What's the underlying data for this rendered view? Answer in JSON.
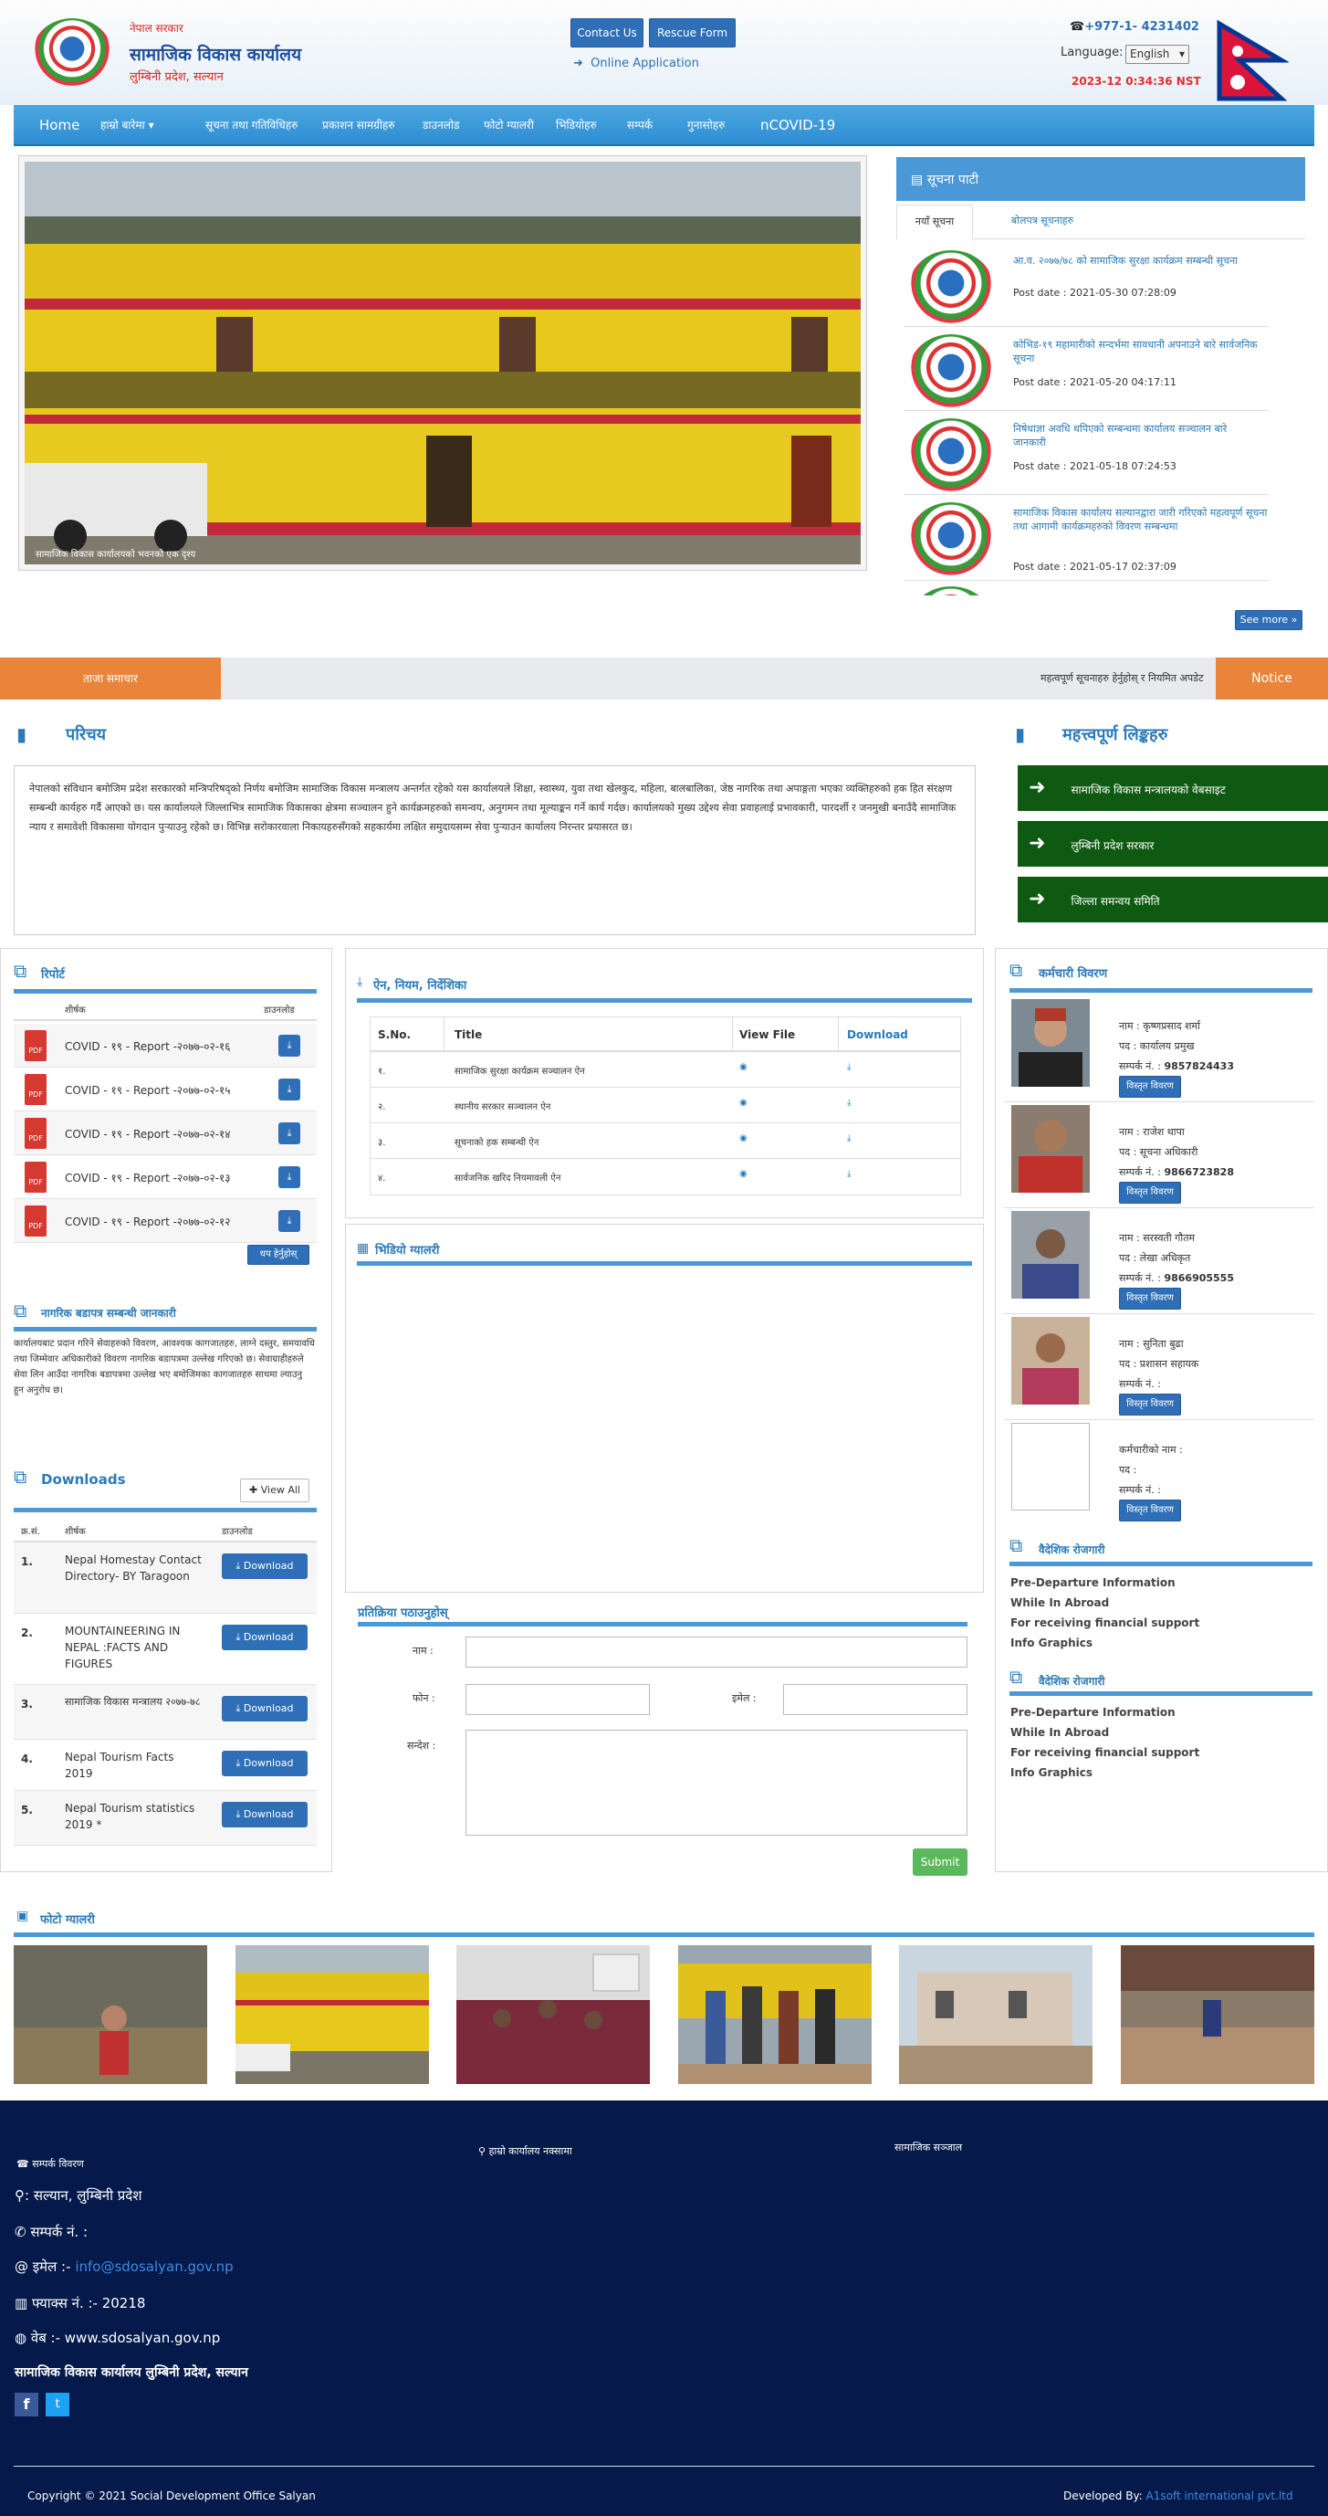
{
  "header": {
    "gov_line1": "नेपाल सरकार",
    "office_name": "सामाजिक विकास कार्यालय",
    "office_sub": "लुम्बिनी प्रदेश, सल्यान",
    "contact_us": "Contact Us",
    "rescue_form": "Rescue Form",
    "online_application": "Online Application",
    "phone": "+977-1- 4231402",
    "language_label": "Language:",
    "language_selected": "English",
    "datetime": "2023-12 0:34:36 NST"
  },
  "nav": {
    "items": [
      "Home",
      "हाम्रो बारेमा",
      "सूचना तथा गतिविधिहरु",
      "प्रकाशन सामग्रीहरु",
      "डाउनलोड",
      "फोटो ग्यालरी",
      "भिडियोहरु",
      "सम्पर्क",
      "गुनासोहरु",
      "nCOVID-19"
    ]
  },
  "slider": {
    "caption": "सामाजिक विकास कार्यालयको भवनको एक दृश्य"
  },
  "news": {
    "title": "सूचना पाटी",
    "tabs": [
      "नयाँ सूचना",
      "बोलपत्र सूचनाहरु"
    ],
    "items": [
      {
        "text": "आ.व. २०७७/७८ को सामाजिक सुरक्षा कार्यक्रम सम्बन्धी सूचना",
        "date": "Post date : 2021-05-30 07:28:09"
      },
      {
        "text": "कोभिड-१९ महामारीको सन्दर्भमा सावधानी अपनाउने बारे सार्वजनिक सूचना",
        "date": "Post date : 2021-05-20 04:17:11"
      },
      {
        "text": "निषेधाज्ञा अवधि थपिएको सम्बन्धमा कार्यालय सञ्चालन बारे जानकारी",
        "date": "Post date : 2021-05-18 07:24:53"
      },
      {
        "text": "सामाजिक विकास कार्यालय सल्यानद्वारा जारी गरिएको महत्वपूर्ण सूचना तथा आगामी कार्यक्रमहरुको विवरण सम्बन्धमा",
        "date": "Post date : 2021-05-17 02:37:09"
      }
    ],
    "see_more": "See more »"
  },
  "ticker": {
    "label": "ताजा समाचार",
    "text": "महत्वपूर्ण सूचनाहरु हेर्नुहोस् र नियमित अपडेट रहनुहोस्",
    "notice": "Notice"
  },
  "intro": {
    "title": "परिचय",
    "body": "नेपालको संविधान बमोजिम प्रदेश सरकारको मन्त्रिपरिषद्को निर्णय बमोजिम सामाजिक विकास मन्त्रालय अन्तर्गत रहेको यस कार्यालयले शिक्षा, स्वास्थ्य, युवा तथा खेलकुद, महिला, बालबालिका, जेष्ठ नागरिक तथा अपाङ्गता भएका व्यक्तिहरुको हक हित संरक्षण सम्बन्धी कार्यहरु गर्दै आएको छ। यस कार्यालयले जिल्लाभित्र सामाजिक विकासका क्षेत्रमा सञ्चालन हुने कार्यक्रमहरुको समन्वय, अनुगमन तथा मूल्याङ्कन गर्ने कार्य गर्दछ। कार्यालयको मुख्य उद्देश्य सेवा प्रवाहलाई प्रभावकारी, पारदर्शी र जनमुखी बनाउँदै सामाजिक न्याय र समावेशी विकासमा योगदान पुर्‍याउनु रहेको छ। विभिन्न सरोकारवाला निकायहरुसँगको सहकार्यमा लक्षित समुदायसम्म सेवा पुर्‍याउन कार्यालय निरन्तर प्रयासरत छ।"
  },
  "quick_links": {
    "title": "महत्त्वपूर्ण लिङ्कहरु",
    "items": [
      "सामाजिक विकास मन्त्रालयको वेबसाइट",
      "लुम्बिनी प्रदेश सरकार",
      "जिल्ला समन्वय समिति"
    ]
  },
  "reports": {
    "title": "रिपोर्ट",
    "col_name": "शीर्षक",
    "col_dl": "डाउनलोड",
    "items": [
      "COVID - १९ - Report -२०७७-०२-१६",
      "COVID - १९ - Report -२०७७-०२-१५",
      "COVID - १९ - Report -२०७७-०२-१४",
      "COVID - १९ - Report -२०७७-०२-१३",
      "COVID - १९ - Report -२०७७-०२-१२"
    ],
    "view_all": "थप हेर्नुहोस्"
  },
  "citizen": {
    "title": "नागरिक बडापत्र सम्बन्धी जानकारी",
    "body": "कार्यालयबाट प्रदान गरिने सेवाहरुको विवरण, आवश्यक कागजातहरु, लाग्ने दस्तुर, समयावधि तथा जिम्मेवार अधिकारीको विवरण नागरिक बडापत्रमा उल्लेख गरिएको छ। सेवाग्राहीहरुले सेवा लिन आउँदा नागरिक बडापत्रमा उल्लेख भए बमोजिमका कागजातहरु साथमा ल्याउनु हुन अनुरोध छ।"
  },
  "downloads": {
    "title": "Downloads",
    "view_all": "View All",
    "col_sn": "क्र.सं.",
    "col_name": "शीर्षक",
    "col_dl": "डाउनलोड",
    "button": "Download",
    "items": [
      {
        "sn": "1.",
        "name": "Nepal Homestay Contact Directory- BY Taragoon"
      },
      {
        "sn": "2.",
        "name": "MOUNTAINEERING IN NEPAL :FACTS AND FIGURES"
      },
      {
        "sn": "3.",
        "name": "सामाजिक विकास मन्त्रालय २०७७-७८"
      },
      {
        "sn": "4.",
        "name": "Nepal Tourism Facts 2019"
      },
      {
        "sn": "5.",
        "name": "Nepal Tourism statistics 2019 *"
      }
    ]
  },
  "acts": {
    "title": "ऐन, नियम, निर्देशिका",
    "cols": [
      "S.No.",
      "Title",
      "View File",
      "Download"
    ],
    "rows": [
      {
        "sn": "१.",
        "title": "सामाजिक सुरक्षा कार्यक्रम सञ्चालन ऐन"
      },
      {
        "sn": "२.",
        "title": "स्थानीय सरकार सञ्चालन ऐन"
      },
      {
        "sn": "३.",
        "title": "सूचनाको हक सम्बन्धी ऐन"
      },
      {
        "sn": "४.",
        "title": "सार्वजनिक खरिद नियमावली ऐन"
      }
    ]
  },
  "video": {
    "title": "भिडियो ग्यालरी"
  },
  "feedback": {
    "title": "प्रतिक्रिया पठाउनुहोस्",
    "name_label": "नाम :",
    "phone_label": "फोन :",
    "email_label": "इमेल :",
    "message_label": "सन्देश :",
    "submit": "Submit"
  },
  "staff": {
    "title": "कर्मचारी विवरण",
    "detail_button": "विस्तृत विवरण",
    "items": [
      {
        "name": "नाम : कृष्णप्रसाद शर्मा",
        "post": "पद : कार्यालय प्रमुख",
        "phone_label": "सम्पर्क नं. :",
        "phone": "9857824433"
      },
      {
        "name": "नाम : राजेश थापा",
        "post": "पद : सूचना अधिकारी",
        "phone_label": "सम्पर्क नं. :",
        "phone": "9866723828"
      },
      {
        "name": "नाम : सरस्वती गौतम",
        "post": "पद : लेखा अधिकृत",
        "phone_label": "सम्पर्क नं. :",
        "phone": "9866905555"
      },
      {
        "name": "नाम : सुनिता बुढा",
        "post": "पद : प्रशासन सहायक",
        "phone_label": "सम्पर्क नं. :",
        "phone": ""
      },
      {
        "name": "कर्मचारीको नाम :",
        "post": "पद :",
        "phone_label": "सम्पर्क नं. :",
        "phone": ""
      }
    ]
  },
  "links1": {
    "title": "वैदेशिक रोजगारी",
    "items": [
      "Pre-Departure Information",
      "While In Abroad",
      "For receiving financial support",
      "Info Graphics"
    ]
  },
  "links2": {
    "title": "वैदेशिक रोजगारी",
    "items": [
      "Pre-Departure Information",
      "While In Abroad",
      "For receiving financial support",
      "Info Graphics"
    ]
  },
  "gallery": {
    "title": "फोटो ग्यालरी"
  },
  "footer": {
    "contact_title": "सम्पर्क विवरण",
    "map_title": "हाम्रो कार्यालय नक्सामा",
    "social_title": "सामाजिक सञ्जाल",
    "address": ": सल्यान, लुम्बिनी प्रदेश",
    "phone": "सम्पर्क नं. :",
    "email_label": "इमेल :-",
    "email": "info@sdosalyan.gov.np",
    "fax": "फ्याक्स नं. :- 20218",
    "web": "वेब :- www.sdosalyan.gov.np",
    "office": "सामाजिक विकास कार्यालय लुम्बिनी प्रदेश, सल्यान",
    "copyright": "Copyright © 2021 Social Development Office Salyan",
    "developed_label": "Developed By:",
    "developed_by": "A1soft international pvt.ltd"
  },
  "colors": {
    "nav": "#3a9ad9",
    "accent": "#2a7ab8",
    "ticker_orange": "#e9843a",
    "footer": "#051a4a",
    "green": "#0e5a12",
    "red_date": "#e23030"
  }
}
